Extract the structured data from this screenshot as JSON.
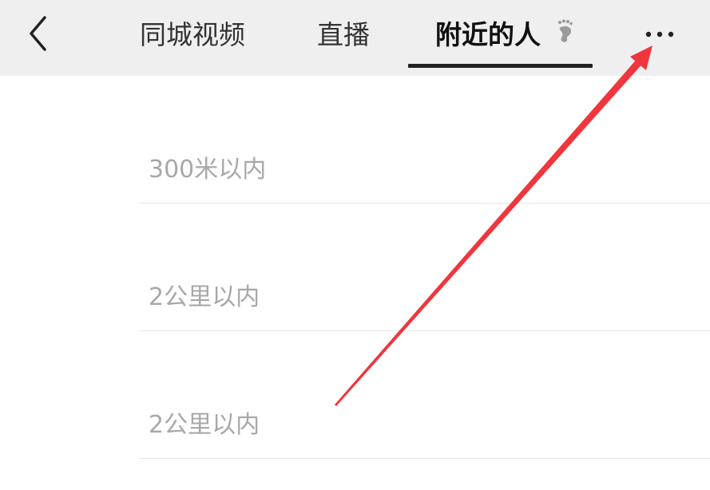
{
  "header": {
    "back_icon": "chevron-left-icon",
    "tabs": [
      {
        "label": "同城视频",
        "active": false
      },
      {
        "label": "直播",
        "active": false
      },
      {
        "label": "附近的人",
        "active": true,
        "icon": "footprint-icon"
      }
    ],
    "more_icon": "more-horizontal-icon"
  },
  "distance_options": [
    {
      "label": "300米以内"
    },
    {
      "label": "2公里以内"
    },
    {
      "label": "2公里以内"
    }
  ],
  "annotation": {
    "type": "arrow",
    "color": "#f0353c",
    "points_to": "more-button"
  },
  "colors": {
    "header_bg": "#efefef",
    "text_dark": "#333333",
    "text_muted": "#a8a8a8",
    "divider": "#e6e6e6",
    "arrow": "#f0353c"
  }
}
